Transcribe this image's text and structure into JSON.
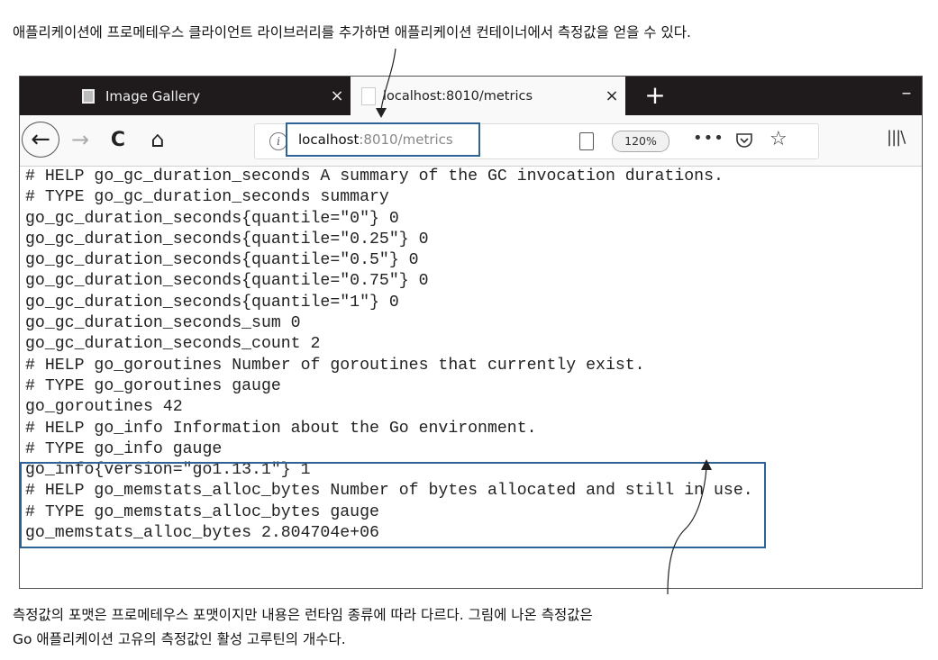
{
  "caption_top": "애플리케이션에 프로메테우스 클라이언트 라이브러리를 추가하면 애플리케이션 컨테이너에서 측정값을 얻을 수 있다.",
  "caption_bottom": [
    "측정값의 포맷은 프로메테우스 포맷이지만 내용은 런타임 종류에 따라 다르다. 그림에 나온 측정값은",
    "Go 애플리케이션 고유의 측정값인 활성 고루틴의 개수다."
  ],
  "tabs": [
    {
      "title": "Image Gallery",
      "close": "×"
    },
    {
      "title": "localhost:8010/metrics",
      "close": "×"
    }
  ],
  "new_tab": "+",
  "window_minimize": "–",
  "nav": {
    "back": "←",
    "forward": "→",
    "reload": "C",
    "home": "⌂"
  },
  "urlbar": {
    "host": "localhost",
    "rest": ":8010/metrics",
    "zoom": "120%",
    "more": "•••"
  },
  "colors": {
    "highlight": "#2f6395",
    "tabbar": "#1f1a1c"
  },
  "metrics_lines": [
    "# HELP go_gc_duration_seconds A summary of the GC invocation durations.",
    "# TYPE go_gc_duration_seconds summary",
    "go_gc_duration_seconds{quantile=\"0\"} 0",
    "go_gc_duration_seconds{quantile=\"0.25\"} 0",
    "go_gc_duration_seconds{quantile=\"0.5\"} 0",
    "go_gc_duration_seconds{quantile=\"0.75\"} 0",
    "go_gc_duration_seconds{quantile=\"1\"} 0",
    "go_gc_duration_seconds_sum 0",
    "go_gc_duration_seconds_count 2",
    "# HELP go_goroutines Number of goroutines that currently exist.",
    "# TYPE go_goroutines gauge",
    "go_goroutines 42",
    "# HELP go_info Information about the Go environment.",
    "# TYPE go_info gauge",
    "go_info{version=\"go1.13.1\"} 1",
    "# HELP go_memstats_alloc_bytes Number of bytes allocated and still in use.",
    "# TYPE go_memstats_alloc_bytes gauge",
    "go_memstats_alloc_bytes 2.804704e+06"
  ]
}
